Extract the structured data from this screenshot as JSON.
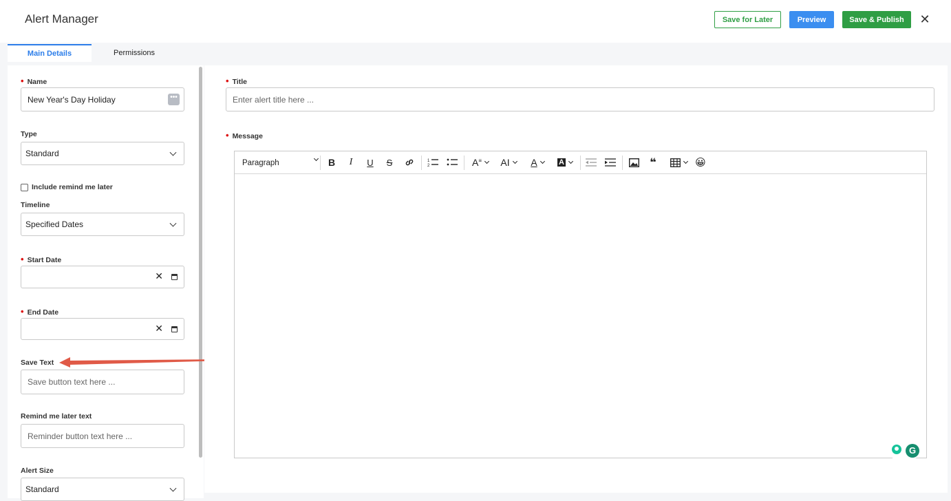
{
  "header": {
    "title": "Alert Manager",
    "save_later_label": "Save for Later",
    "preview_label": "Preview",
    "publish_label": "Save & Publish",
    "close_symbol": "✕"
  },
  "tabs": [
    {
      "label": "Main Details",
      "active": true
    },
    {
      "label": "Permissions",
      "active": false
    }
  ],
  "form": {
    "name_label": "Name",
    "name_value": "New Year's Day Holiday",
    "type_label": "Type",
    "type_value": "Standard",
    "remind_checkbox_label": "Include remind me later",
    "remind_checked": false,
    "timeline_label": "Timeline",
    "timeline_value": "Specified Dates",
    "start_date_label": "Start Date",
    "start_date_value": "",
    "end_date_label": "End Date",
    "end_date_value": "",
    "save_text_label": "Save Text",
    "save_text_placeholder": "Save button text here ...",
    "remind_text_label": "Remind me later text",
    "remind_text_placeholder": "Reminder button text here ...",
    "alert_size_label": "Alert Size",
    "alert_size_value": "Standard"
  },
  "content": {
    "title_label": "Title",
    "title_placeholder": "Enter alert title here ...",
    "message_label": "Message",
    "paragraph_style": "Paragraph"
  },
  "toolbar": {
    "bold": "B",
    "italic": "I",
    "underline": "U",
    "strikethrough": "S",
    "font_size": "A",
    "text_case": "AI",
    "font_color": "A",
    "highlight": "A",
    "quote": "❝",
    "emoji": "😀"
  },
  "colors": {
    "accent_blue": "#2b7de9",
    "publish_green": "#2f9e44",
    "required_red": "#dd1111",
    "annotation_arrow": "#e05a47"
  },
  "icons": [
    "more-dots-icon",
    "chevron-down-icon",
    "clear-icon",
    "calendar-icon",
    "close-icon",
    "link-icon",
    "ordered-list-icon",
    "bullet-list-icon",
    "outdent-icon",
    "indent-icon",
    "image-icon",
    "table-icon",
    "grammarly-icon"
  ]
}
